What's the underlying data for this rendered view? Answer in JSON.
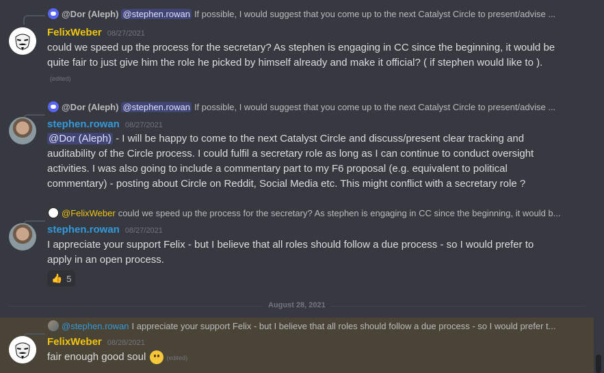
{
  "messages": [
    {
      "reply": {
        "name": "@Dor (Aleph)",
        "mention": "@stephen.rowan",
        "text": "If possible, I would suggest that you come up to the next Catalyst Circle to present/advise ..."
      },
      "author": "FelixWeber",
      "timestamp": "08/27/2021",
      "text": "could we speed up the process for the secretary? As stephen is engaging in CC since the beginning, it would be quite fair to just give him the role he picked by himself already and make it official? ( if stephen would like to ).",
      "edited": "(edited)"
    },
    {
      "reply": {
        "name": "@Dor (Aleph)",
        "mention": "@stephen.rowan",
        "text": "If possible, I would suggest that you come up to the next Catalyst Circle to present/advise ..."
      },
      "author": "stephen.rowan",
      "timestamp": "08/27/2021",
      "mention": "@Dor (Aleph)",
      "text": " - I will be happy to come to the next Catalyst Circle and discuss/present clear tracking and auditability of the Circle process. I could fulfil a secretary role as long as I can continue to conduct oversight activities. I was also going to include a commentary part to my F6 proposal (e.g. equivalent to political commentary) - posting about Circle on Reddit, Social Media etc. This might conflict with a secretary role ?"
    },
    {
      "reply": {
        "name": "@FelixWeber",
        "text": "could we speed up the process for the secretary? As stephen is engaging in CC since the beginning, it would b..."
      },
      "author": "stephen.rowan",
      "timestamp": "08/27/2021",
      "text": "I appreciate your support Felix - but I believe that all roles should follow a due process - so I would prefer to apply in an open process.",
      "reaction": {
        "emoji": "👍",
        "count": "5"
      }
    },
    {
      "reply": {
        "name": "@stephen.rowan",
        "text": "I appreciate your support Felix - but I believe that all roles should follow a due process - so I would prefer t..."
      },
      "author": "FelixWeber",
      "timestamp": "08/28/2021",
      "text": "fair enough good soul",
      "edited": "(edited)"
    }
  ],
  "divider": "August 28, 2021",
  "colors": {
    "felix": "#f1c40f",
    "stephen": "#3498db",
    "highlight": "#4a4436"
  }
}
